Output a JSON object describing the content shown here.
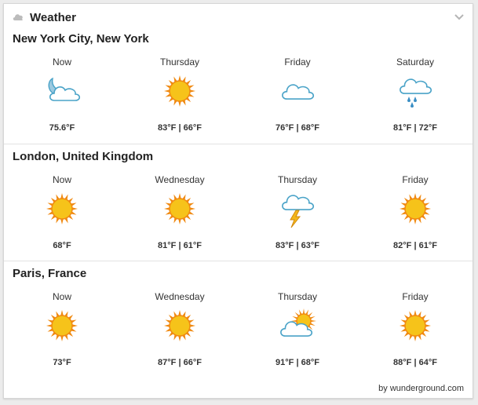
{
  "header": {
    "title": "Weather",
    "cloud_icon": "cloud-icon",
    "collapse_icon": "chevron-down-icon"
  },
  "locations": [
    {
      "name": "New York City, New York",
      "days": [
        {
          "label": "Now",
          "temp": "75.6°F",
          "icon": "moon-cloud-icon"
        },
        {
          "label": "Thursday",
          "temp": "83°F | 66°F",
          "icon": "sun-icon"
        },
        {
          "label": "Friday",
          "temp": "76°F | 68°F",
          "icon": "cloud-icon"
        },
        {
          "label": "Saturday",
          "temp": "81°F | 72°F",
          "icon": "rain-cloud-icon"
        }
      ]
    },
    {
      "name": "London, United Kingdom",
      "days": [
        {
          "label": "Now",
          "temp": "68°F",
          "icon": "sun-icon"
        },
        {
          "label": "Wednesday",
          "temp": "81°F | 61°F",
          "icon": "sun-icon"
        },
        {
          "label": "Thursday",
          "temp": "83°F | 63°F",
          "icon": "thunderstorm-icon"
        },
        {
          "label": "Friday",
          "temp": "82°F | 61°F",
          "icon": "sun-icon"
        }
      ]
    },
    {
      "name": "Paris, France",
      "days": [
        {
          "label": "Now",
          "temp": "73°F",
          "icon": "sun-icon"
        },
        {
          "label": "Wednesday",
          "temp": "87°F | 66°F",
          "icon": "sun-icon"
        },
        {
          "label": "Thursday",
          "temp": "91°F | 68°F",
          "icon": "partly-cloudy-icon"
        },
        {
          "label": "Friday",
          "temp": "88°F | 64°F",
          "icon": "sun-icon"
        }
      ]
    }
  ],
  "footer": {
    "credit": "by wunderground.com"
  },
  "colors": {
    "sun_fill": "#f6c31a",
    "sun_ray": "#f08a12",
    "cloud_fill": "#ffffff",
    "cloud_stroke": "#4aa3c8",
    "rain": "#3a8ec4",
    "bolt": "#f3b71a"
  }
}
